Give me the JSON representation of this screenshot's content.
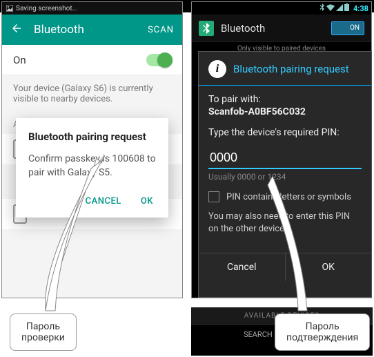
{
  "left": {
    "status_text": "Saving screenshot...",
    "header": {
      "title": "Bluetooth",
      "scan": "SCAN"
    },
    "on_label": "On",
    "visibility_info": "Your device (Galaxy S6) is currently visible to nearby devices.",
    "available_label": "Available devices",
    "modal": {
      "title": "Bluetooth pairing request",
      "text": "Confirm passkey is 100608 to pair with Galaxy S5.",
      "cancel": "CANCEL",
      "ok": "OK"
    }
  },
  "right": {
    "status": {
      "time": "4:38"
    },
    "header": {
      "title": "Bluetooth",
      "switch": "ON"
    },
    "visibility": "Only visible to paired devices",
    "modal": {
      "title": "Bluetooth pairing request",
      "pair_with_label": "To pair with:",
      "device": "Scanfob-A0BF56C032",
      "type_pin_label": "Type the device's required PIN:",
      "pin_value": "0000",
      "pin_hint": "Usually 0000 or 1234",
      "check_label": "PIN contains letters or symbols",
      "note": "You may also need to enter this PIN on the other device.",
      "cancel": "Cancel",
      "ok": "OK"
    },
    "available": "AVAILABLE DEVICES",
    "search": "SEARCH FOR DEVICES"
  },
  "callouts": {
    "left": "Пароль проверки",
    "right": "Пароль подтверждения"
  }
}
